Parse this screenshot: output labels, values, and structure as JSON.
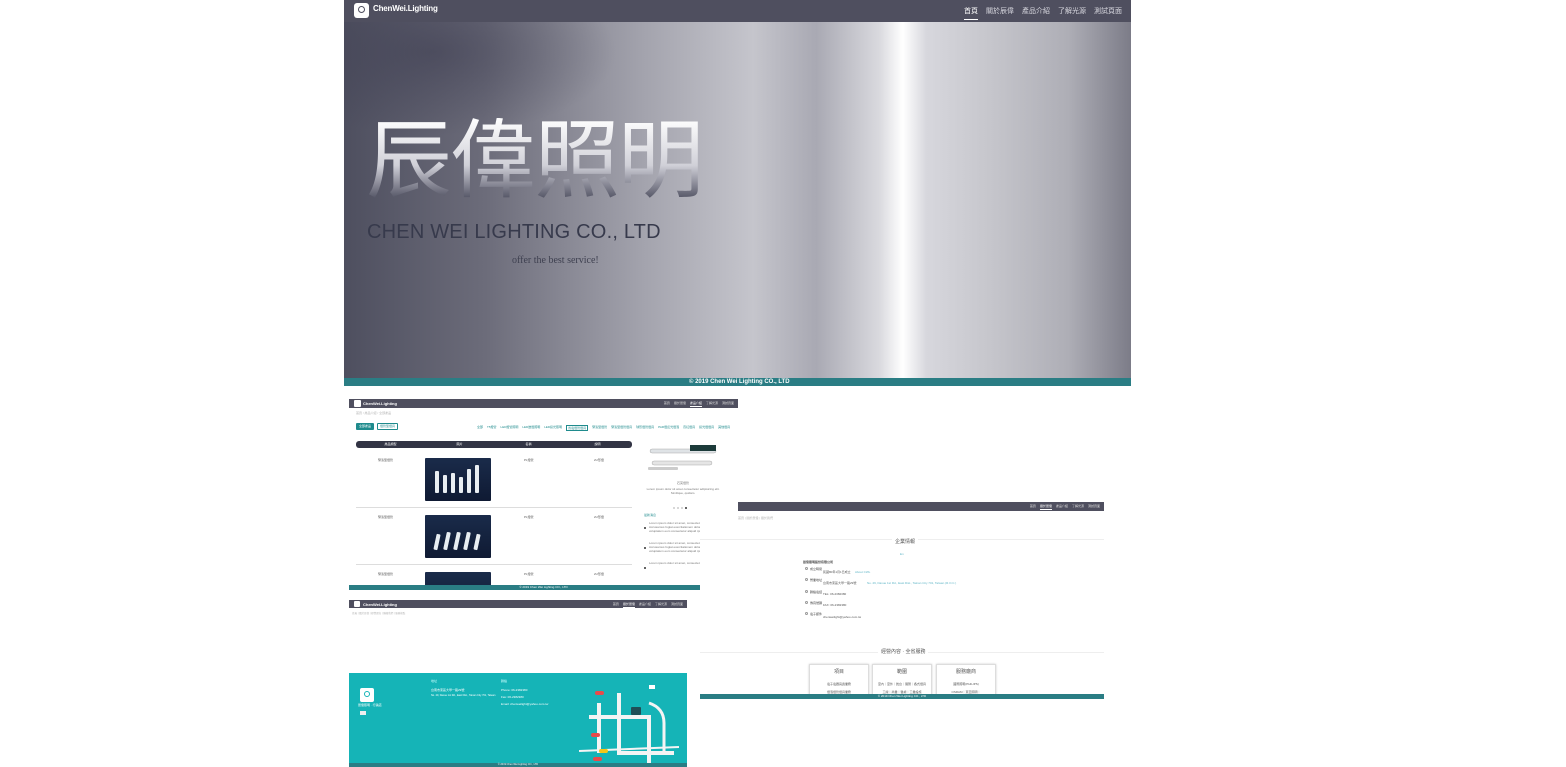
{
  "hero": {
    "brand": "ChenWei.Lighting",
    "nav": [
      "首頁",
      "關於辰偉",
      "產品介紹",
      "了解光源",
      "測試頁面"
    ],
    "title": "辰偉照明",
    "subtitle": "CHEN WEI LIGHTING CO., LTD",
    "tagline": "offer the best service!",
    "footer": "© 2019 Chen Wei Lighting CO., LTD"
  },
  "product": {
    "brand": "ChenWei.Lighting",
    "nav": [
      "首頁",
      "關於辰偉",
      "產品介紹",
      "了解光源",
      "測試頁面"
    ],
    "breadcrumb": [
      "首頁",
      "產品介紹",
      "全部產品"
    ],
    "btn_primary": "全部產品",
    "btn_secondary": "燈管型燈具",
    "categories": [
      "全部",
      "T5燈管",
      "LED燈管照明",
      "LED嵌燈照明",
      "LED投光照明",
      "省電燈管燈具",
      "緊湊型燈管",
      "緊湊型燈管燈具",
      "球形燈管燈具",
      "PAR燈反光燈泡",
      "霓虹燈具",
      "投光燈燈具",
      "其他燈具",
      "其他"
    ],
    "table_headers": [
      "產品類型",
      "圖片",
      "名稱",
      "說明"
    ],
    "rows": [
      {
        "type": "緊湊型燈管",
        "name": "PL燈管",
        "desc": "2U形燈"
      },
      {
        "type": "緊湊型燈管",
        "name": "PL燈管",
        "desc": "2U形燈"
      },
      {
        "type": "緊湊型燈管",
        "name": "PL燈管",
        "desc": "2U形燈"
      }
    ],
    "side_caption": "石英燈管",
    "side_desc": "Lorem ipsum dolor sit amet consectetur adipisicing elit. Similique, quidam.",
    "news_title": "最新消息",
    "news": [
      "Lorem ipsum dolor sit amet, consectetur adipisicing elit. Accusamus fugiat exercitationem doloribus soluta iste voluptatum eum consectetur aliquid ipsum voluptatibus.",
      "Lorem ipsum dolor sit amet, consectetur adipisicing elit. Accusamus fugiat exercitationem doloribus soluta iste voluptatum eum consectetur aliquid ipsum voluptatibus.",
      "Lorem ipsum dolor sit amet, consectetur adipisicing elit."
    ],
    "footer": "© 2019 Chen Wei Lighting CO., LTD"
  },
  "company": {
    "nav": [
      "首頁",
      "關於辰偉",
      "產品介紹",
      "了解光源",
      "測試頁面"
    ],
    "breadcrumb": [
      "首頁",
      "關於辰偉",
      "關於我們"
    ],
    "section_title": "企業情報",
    "section_sub": "En",
    "company_name": "辰偉照明股份有限公司",
    "fields": [
      {
        "label": "成立時間",
        "value": "民國80年1月1日成立",
        "link": "About CWL"
      },
      {
        "label": "營業地址",
        "value": "台南市東區大學一路29號",
        "link": "No. 29, Daxue 1st Rd., East Dist., Tainan City 701, Taiwan (R.O.C.)"
      },
      {
        "label": "聯絡電話",
        "value": "TEL: 06-2382380"
      },
      {
        "label": "傳真號碼",
        "value": "FAX: 06-2382380"
      },
      {
        "label": "電子郵件",
        "value": "chenweilight@yahoo.com.tw"
      }
    ],
    "business_title": "經營內容 · 全省服務",
    "cards": [
      {
        "title": "項目",
        "lines": [
          "電子電器買賣業務",
          "燈泡燈管燈具業務"
        ]
      },
      {
        "title": "範圍",
        "lines": [
          "室內｜室外｜舞台｜展覽｜各式燈具",
          "工廠｜商業｜醫療｜工業設施"
        ]
      },
      {
        "title": "服務廠商",
        "lines": [
          "國際照明(PHILIPS)",
          "OSRAM｜東亞照明｜"
        ]
      }
    ],
    "footer": "© 2019 Chen Wei Lighting CO., LTD"
  },
  "contact": {
    "brand": "ChenWei.Lighting",
    "nav": [
      "首頁",
      "關於辰偉",
      "產品介紹",
      "了解光源",
      "測試頁面"
    ],
    "breadcrumb": [
      "首頁",
      "關於辰偉",
      "經營理念",
      "聯絡我們",
      "服務據點"
    ],
    "logo_caption": "辰偉照明 · 行銷店",
    "address_head": "地址",
    "address": "台南市東區大學一路29號",
    "address_en": "No. 29, Daxue 1st Rd., East Dist., Tainan City 701, Taiwan",
    "contact_head": "聯絡",
    "phone": "Phone: 06-2382380",
    "fax": "Fax: 06-2382380",
    "email": "Email: chenweilight@yahoo.com.tw",
    "footer": "© 2019 Chen Wei Lighting CO., LTD"
  },
  "colors": {
    "nav_bg": "#4f4f5f",
    "teal": "#15b4b7",
    "footer_teal": "#2a7d84"
  }
}
